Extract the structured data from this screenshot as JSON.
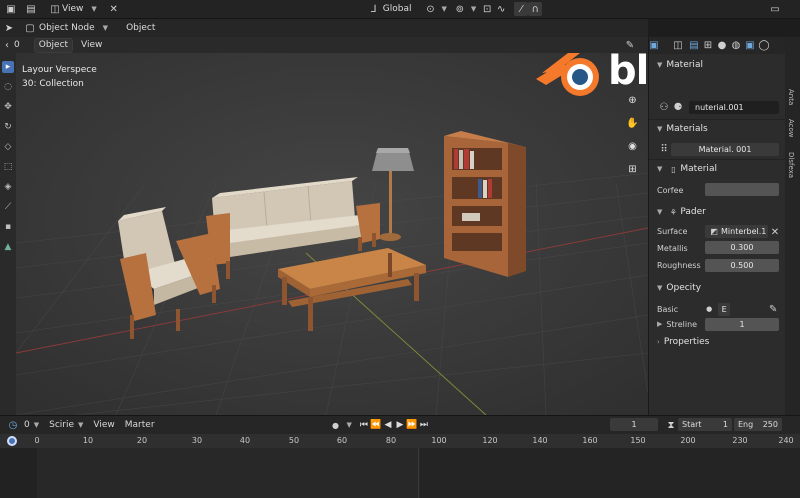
{
  "top_bar": {
    "menu_view": "View",
    "orientation": "Global",
    "right_icon": "window-icon"
  },
  "header2": {
    "mode": "Object Node",
    "object_menu": "Object"
  },
  "header3": {
    "layer_num": "0",
    "object_menu": "Object",
    "view_menu": "View"
  },
  "viewport": {
    "info_line1": "Layour Verspece",
    "info_line2": "30: Collection"
  },
  "logo": {
    "text": "blender"
  },
  "properties": {
    "section_material_top": "Material",
    "material_slot_name": "nuterial.001",
    "section_materials": "Materials",
    "materials_field": "Material. 001",
    "section_material": "Material",
    "corfee_label": "Corfee",
    "section_pader": "Pader",
    "surface_label": "Surface",
    "surface_value": "Minterbel.1",
    "metallis_label": "Metallis",
    "metallis_value": "0.300",
    "roughness_label": "Roughness",
    "roughness_value": "0.500",
    "section_opecity": "Opecity",
    "basic_label": "Basic",
    "basic_value": "E",
    "streline_label": "Streline",
    "streline_value": "1",
    "section_properties": "Properties"
  },
  "side_tabs": [
    "Anta",
    "Acow",
    "Dlsfexa"
  ],
  "timeline": {
    "frame_field": "0",
    "scene_menu": "Scirie",
    "view_menu": "View",
    "marker_menu": "Marter",
    "current_frame": "1",
    "start_label": "Start",
    "start_value": "1",
    "end_label": "Eng",
    "end_value": "250",
    "ticks": [
      "0",
      "10",
      "20",
      "30",
      "40",
      "50",
      "60",
      "80",
      "100",
      "120",
      "140",
      "160",
      "150",
      "200",
      "230",
      "240"
    ]
  },
  "colors": {
    "accent": "#4772b3",
    "logo_orange": "#f5792a",
    "logo_blue": "#265787"
  }
}
